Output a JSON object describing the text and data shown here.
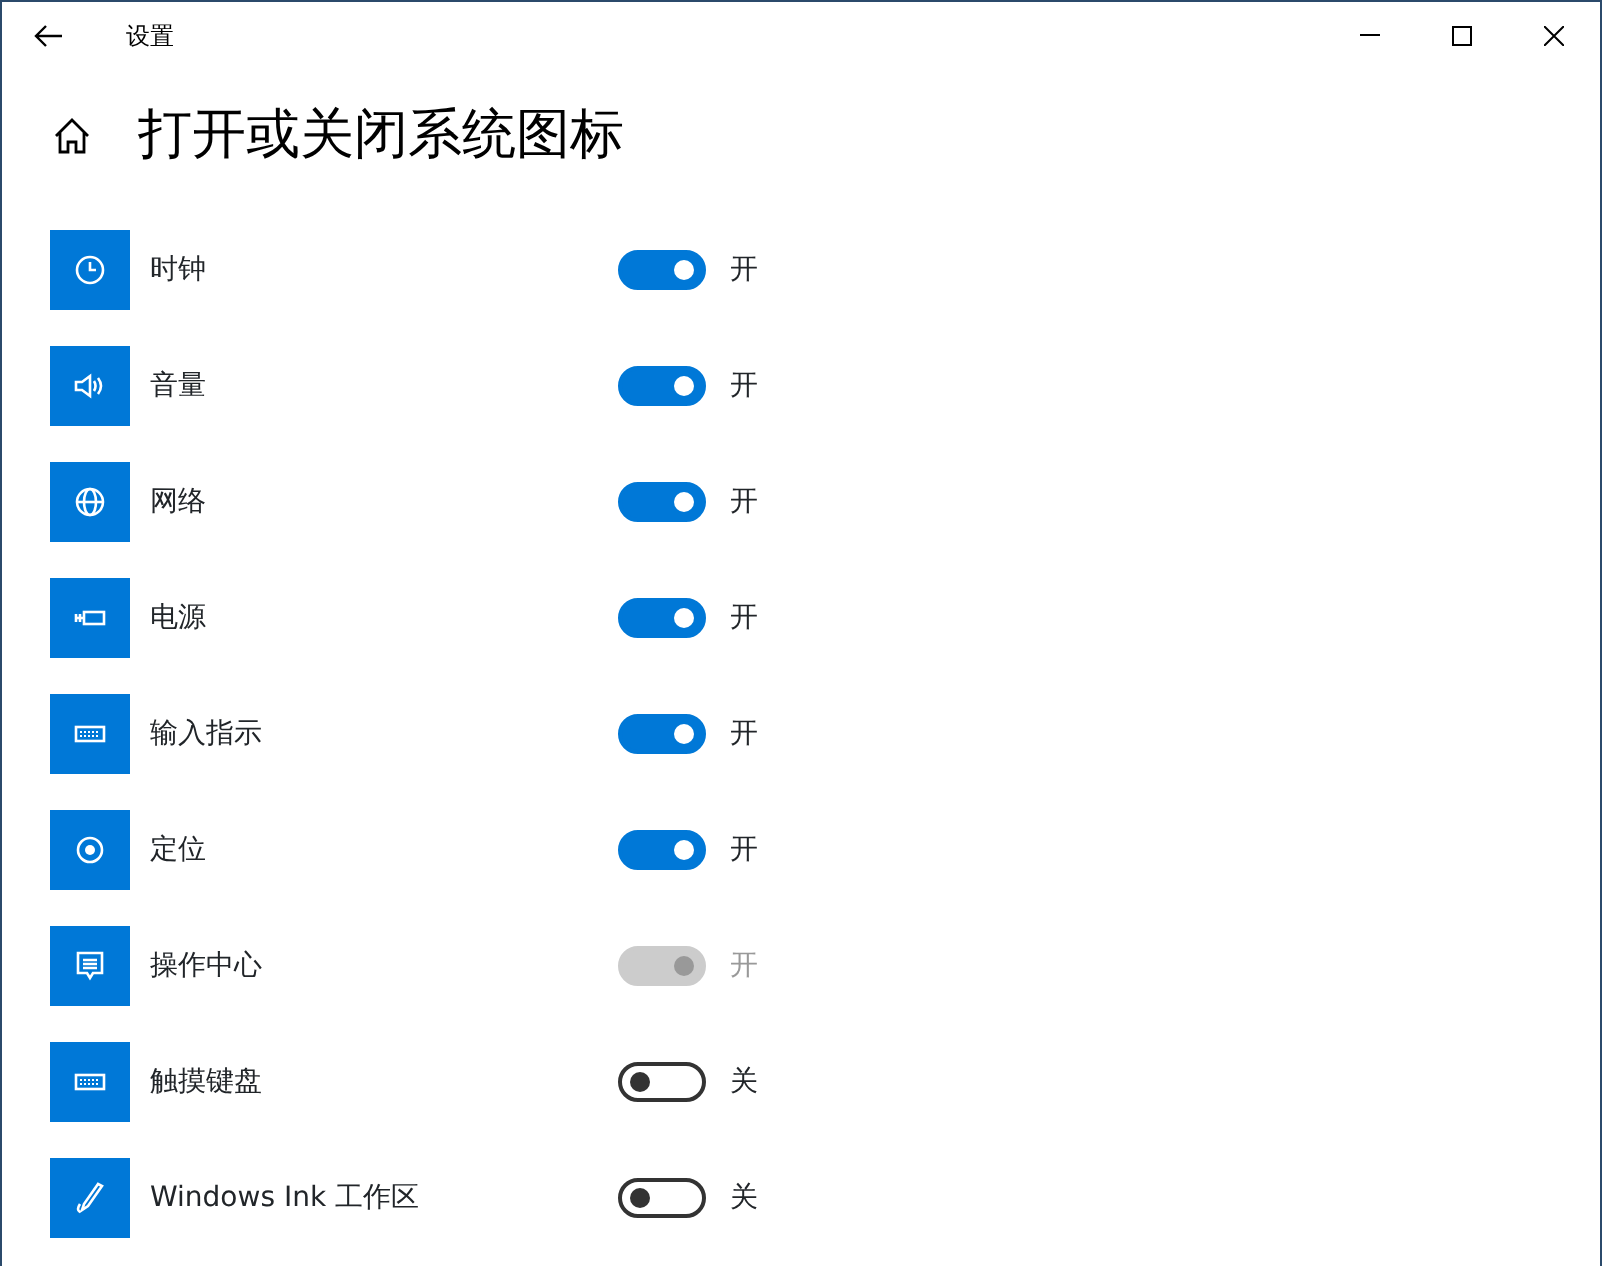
{
  "window": {
    "title": "设置"
  },
  "heading": "打开或关闭系统图标",
  "items": [
    {
      "label": "时钟",
      "on": true,
      "disabled": false,
      "state_text": "开"
    },
    {
      "label": "音量",
      "on": true,
      "disabled": false,
      "state_text": "开"
    },
    {
      "label": "网络",
      "on": true,
      "disabled": false,
      "state_text": "开"
    },
    {
      "label": "电源",
      "on": true,
      "disabled": false,
      "state_text": "开"
    },
    {
      "label": "输入指示",
      "on": true,
      "disabled": false,
      "state_text": "开"
    },
    {
      "label": "定位",
      "on": true,
      "disabled": false,
      "state_text": "开"
    },
    {
      "label": "操作中心",
      "on": true,
      "disabled": true,
      "state_text": "开"
    },
    {
      "label": "触摸键盘",
      "on": false,
      "disabled": false,
      "state_text": "关"
    },
    {
      "label": "Windows Ink 工作区",
      "on": false,
      "disabled": false,
      "state_text": "关"
    }
  ]
}
